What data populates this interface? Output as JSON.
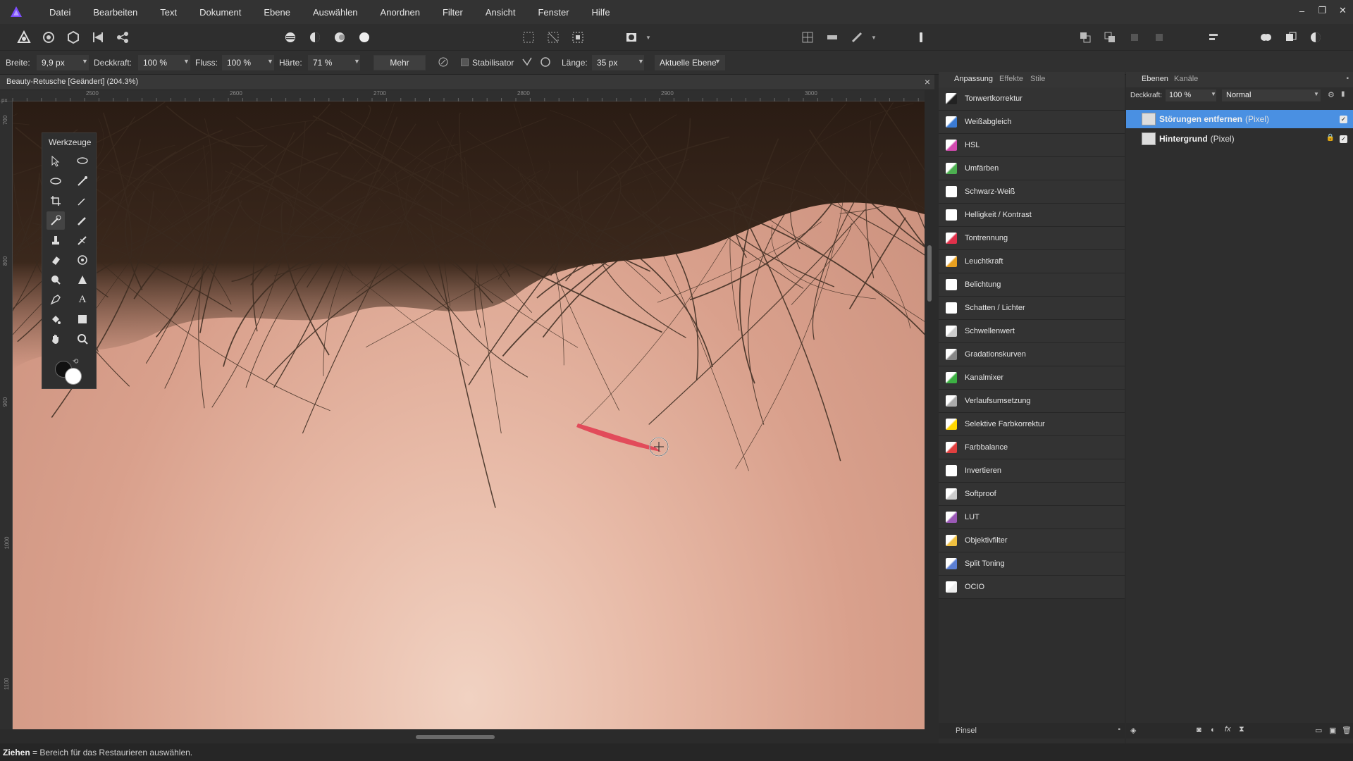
{
  "app": {
    "brand_color": "#7d4dff"
  },
  "menu": [
    "Datei",
    "Bearbeiten",
    "Text",
    "Dokument",
    "Ebene",
    "Auswählen",
    "Anordnen",
    "Filter",
    "Ansicht",
    "Fenster",
    "Hilfe"
  ],
  "window_controls": {
    "minimize": "–",
    "restore": "❐",
    "close": "✕"
  },
  "context_bar": {
    "width_label": "Breite:",
    "width_value": "9,9 px",
    "opacity_label": "Deckkraft:",
    "opacity_value": "100 %",
    "flow_label": "Fluss:",
    "flow_value": "100 %",
    "hardness_label": "Härte:",
    "hardness_value": "71 %",
    "more_label": "Mehr",
    "stabilizer_label": "Stabilisator",
    "length_label": "Länge:",
    "length_value": "35 px",
    "scope_value": "Aktuelle Ebene"
  },
  "document": {
    "title": "Beauty-Retusche [Geändert] (204.3%)",
    "close": "×"
  },
  "ruler": {
    "top_ticks": [
      "2500",
      "2600",
      "2700",
      "2800",
      "2900",
      "3000"
    ],
    "unit": "px",
    "left_ticks": [
      "700",
      "800",
      "900",
      "1000",
      "1100"
    ]
  },
  "tools_panel": {
    "title": "Werkzeuge"
  },
  "adjustment_panel": {
    "tabs": [
      "Anpassung",
      "Effekte",
      "Stile"
    ],
    "items": [
      {
        "label": "Tonwertkorrektur",
        "icon": "levels-icon",
        "color": "#222222"
      },
      {
        "label": "Weißabgleich",
        "icon": "white-balance-icon",
        "color": "#3b7bd4"
      },
      {
        "label": "HSL",
        "icon": "hsl-icon",
        "color": "#d44ab0"
      },
      {
        "label": "Umfärben",
        "icon": "recolor-icon",
        "color": "#4caf50"
      },
      {
        "label": "Schwarz-Weiß",
        "icon": "black-white-icon",
        "color": "#ffffff"
      },
      {
        "label": "Helligkeit / Kontrast",
        "icon": "brightness-icon",
        "color": "#ffffff"
      },
      {
        "label": "Tontrennung",
        "icon": "posterize-icon",
        "color": "#e0304a"
      },
      {
        "label": "Leuchtkraft",
        "icon": "vibrance-icon",
        "color": "#e8a020"
      },
      {
        "label": "Belichtung",
        "icon": "exposure-icon",
        "color": "#ffffff"
      },
      {
        "label": "Schatten / Lichter",
        "icon": "shadows-highlights-icon",
        "color": "#ffffff"
      },
      {
        "label": "Schwellenwert",
        "icon": "threshold-icon",
        "color": "#cccccc"
      },
      {
        "label": "Gradationskurven",
        "icon": "curves-icon",
        "color": "#888888"
      },
      {
        "label": "Kanalmixer",
        "icon": "channel-mixer-icon",
        "color": "#3cb043"
      },
      {
        "label": "Verlaufsumsetzung",
        "icon": "gradient-map-icon",
        "color": "#aaaaaa"
      },
      {
        "label": "Selektive Farbkorrektur",
        "icon": "selective-color-icon",
        "color": "#ffd700"
      },
      {
        "label": "Farbbalance",
        "icon": "color-balance-icon",
        "color": "#e03f3f"
      },
      {
        "label": "Invertieren",
        "icon": "invert-icon",
        "color": "#ffffff"
      },
      {
        "label": "Softproof",
        "icon": "soft-proof-icon",
        "color": "#cccccc"
      },
      {
        "label": "LUT",
        "icon": "lut-icon",
        "color": "#9b59b6"
      },
      {
        "label": "Objektivfilter",
        "icon": "lens-filter-icon",
        "color": "#f0c040"
      },
      {
        "label": "Split Toning",
        "icon": "split-toning-icon",
        "color": "#5b7fd4"
      },
      {
        "label": "OCIO",
        "icon": "ocio-icon",
        "color": "#eeeeee"
      }
    ],
    "footer_label": "Pinsel"
  },
  "layers_panel": {
    "tabs": [
      "Ebenen",
      "Kanäle"
    ],
    "opacity_label": "Deckkraft:",
    "opacity_value": "100 %",
    "blend_mode": "Normal",
    "layers": [
      {
        "name": "Störungen entfernen",
        "type": "(Pixel)",
        "selected": true,
        "locked": false,
        "visible": true
      },
      {
        "name": "Hintergrund",
        "type": "(Pixel)",
        "selected": false,
        "locked": true,
        "visible": true
      }
    ],
    "selected_color": "#4a90e2"
  },
  "status": {
    "action": "Ziehen",
    "hint": "= Bereich für das Restaurieren auswählen."
  }
}
